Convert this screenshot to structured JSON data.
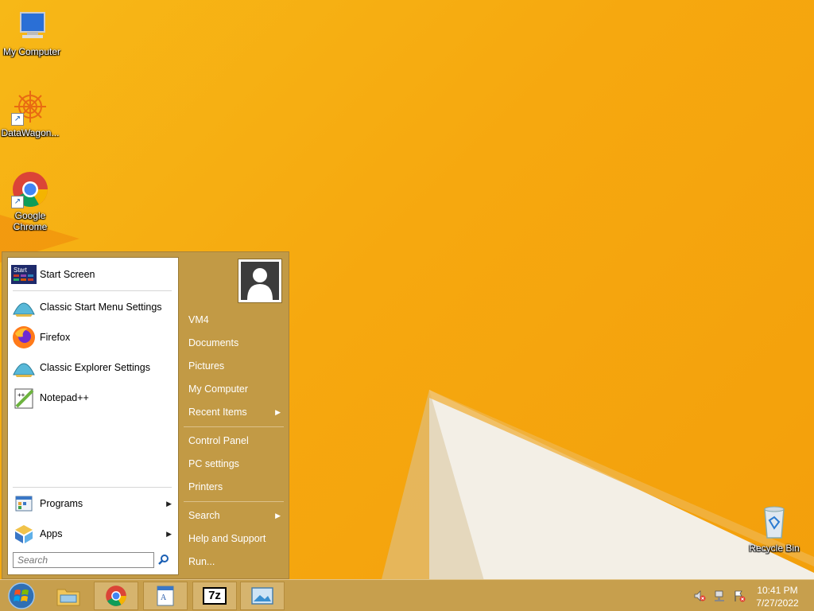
{
  "desktop": {
    "icons": [
      {
        "label": "My Computer"
      },
      {
        "label": "DataWagon..."
      },
      {
        "label": "Google Chrome"
      },
      {
        "label": "Recycle Bin"
      }
    ]
  },
  "start_menu": {
    "pinned": [
      {
        "label": "Start Screen",
        "icon": "start-screen-icon"
      },
      {
        "label": "Classic Start Menu Settings",
        "icon": "shell-icon"
      },
      {
        "label": "Firefox",
        "icon": "firefox-icon"
      },
      {
        "label": "Classic Explorer Settings",
        "icon": "shell-icon"
      },
      {
        "label": "Notepad++",
        "icon": "notepadpp-icon"
      }
    ],
    "programs_label": "Programs",
    "apps_label": "Apps",
    "search_placeholder": "Search",
    "start_tile_text": "Start",
    "right": {
      "user": "VM4",
      "documents": "Documents",
      "pictures": "Pictures",
      "my_computer": "My Computer",
      "recent_items": "Recent Items",
      "control_panel": "Control Panel",
      "pc_settings": "PC settings",
      "printers": "Printers",
      "search": "Search",
      "help_support": "Help and Support",
      "run": "Run..."
    }
  },
  "taskbar": {
    "apps": [
      "start-orb-icon",
      "file-explorer-icon",
      "chrome-icon",
      "wordpad-icon",
      "7zip-icon",
      "picture-viewer-icon"
    ],
    "sevenzip_text": "7z",
    "time": "10:41 PM",
    "date": "7/27/2022"
  },
  "colors": {
    "wallpaper": "#f6a80f",
    "menu_bg": "#c29a45",
    "taskbar": "#c79f4d"
  }
}
